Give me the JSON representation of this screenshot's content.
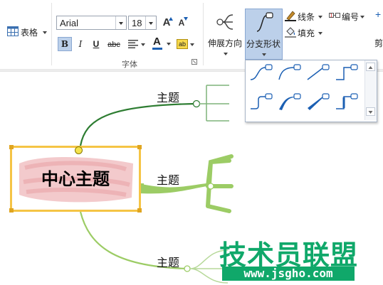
{
  "toolbar": {
    "table_label": "表格",
    "font_name": "Arial",
    "font_size": "18",
    "grow_font": "A",
    "shrink_font": "A",
    "bold": "B",
    "italic": "I",
    "underline": "U",
    "strike": "abc",
    "font_color": "A",
    "highlight": "ab",
    "font_group_label": "字体",
    "expand_direction_label": "伸展方向",
    "branch_shape_label": "分支形状",
    "line_label": "线条",
    "numbering_label": "编号",
    "fill_label": "填充",
    "clip_label": "剪"
  },
  "map": {
    "central_topic": "中心主题",
    "topics": [
      "主题",
      "主题",
      "主题"
    ],
    "colors": {
      "central_border": "#f5c445",
      "branch_dark": "#2e7d32",
      "branch_light": "#9ccc65"
    }
  },
  "watermark": {
    "name": "技术员联盟",
    "url": "www.jsgho.com"
  }
}
